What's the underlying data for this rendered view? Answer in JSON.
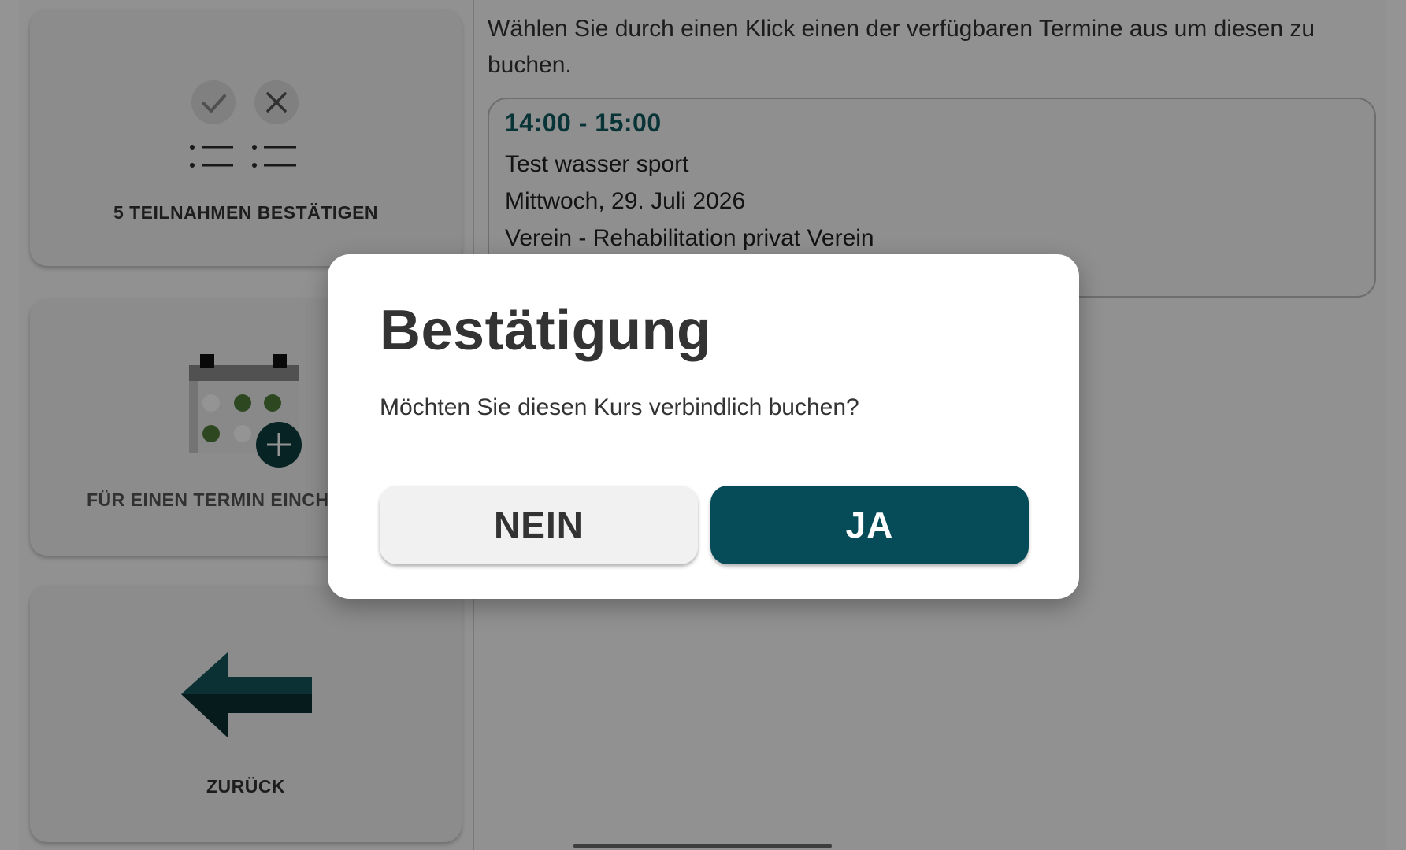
{
  "sidebar": {
    "tiles": [
      {
        "label": "5 TEILNAHMEN BESTÄTIGEN",
        "icon": "checklist-confirm-icon"
      },
      {
        "label": "FÜR EINEN TERMIN EINCHECKEN",
        "icon": "calendar-add-icon"
      },
      {
        "label": "ZURÜCK",
        "icon": "arrow-left-icon"
      }
    ]
  },
  "main": {
    "instruction": "Wählen Sie durch einen Klick einen der verfügbaren Termine aus um diesen zu buchen.",
    "slots": [
      {
        "time": "14:00 - 15:00",
        "course": "Test wasser sport",
        "date": "Mittwoch, 29. Juli 2026",
        "location": "Verein - Rehabilitation privat Verein"
      }
    ]
  },
  "dialog": {
    "title": "Bestätigung",
    "message": "Möchten Sie diesen Kurs verbindlich buchen?",
    "no_label": "NEIN",
    "yes_label": "JA"
  },
  "colors": {
    "accent": "#054b58",
    "time_text": "#0f5a5f",
    "calendar_dot_green": "#4e7d3a",
    "arrow_dark": "#123f42"
  }
}
